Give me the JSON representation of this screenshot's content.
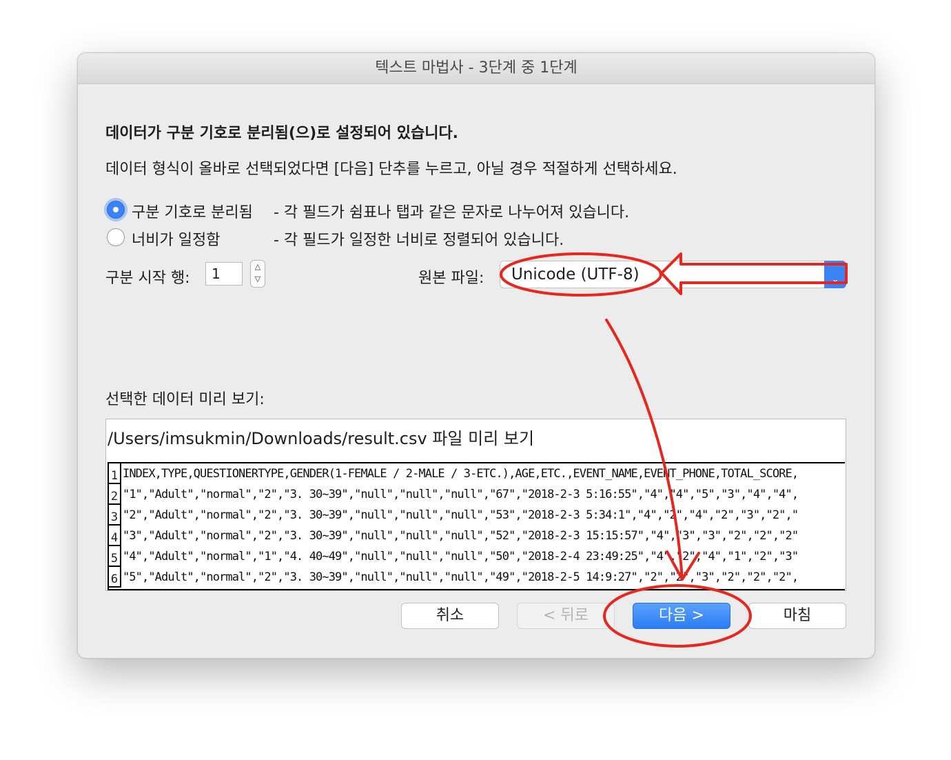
{
  "window": {
    "title": "텍스트 마법사 - 3단계 중 1단계"
  },
  "instructions": {
    "heading": "데이터가 구분 기호로 분리됨(으)로 설정되어 있습니다.",
    "subtext": "데이터 형식이 올바로 선택되었다면 [다음] 단추를 누르고, 아닐 경우 적절하게 선택하세요."
  },
  "options": [
    {
      "label": "구분 기호로 분리됨",
      "description": "- 각 필드가 쉼표나 탭과 같은 문자로 나누어져 있습니다.",
      "selected": true
    },
    {
      "label": "너비가 일정함",
      "description": "- 각 필드가 일정한 너비로 정렬되어 있습니다.",
      "selected": false
    }
  ],
  "start_row": {
    "label": "구분 시작 행:",
    "value": "1"
  },
  "origin": {
    "label": "원본 파일:",
    "value": "Unicode (UTF-8)"
  },
  "preview": {
    "label": "선택한 데이터 미리 보기:",
    "title": "/Users/imsukmin/Downloads/result.csv 파일 미리 보기",
    "rows": [
      {
        "num": "1",
        "text": "INDEX,TYPE,QUESTIONERTYPE,GENDER(1-FEMALE / 2-MALE / 3-ETC.),AGE,ETC.,EVENT_NAME,EVENT_PHONE,TOTAL_SCORE,"
      },
      {
        "num": "2",
        "text": "\"1\",\"Adult\",\"normal\",\"2\",\"3. 30~39\",\"null\",\"null\",\"null\",\"67\",\"2018-2-3 5:16:55\",\"4\",\"4\",\"5\",\"3\",\"4\",\"4\","
      },
      {
        "num": "3",
        "text": "\"2\",\"Adult\",\"normal\",\"2\",\"3. 30~39\",\"null\",\"null\",\"null\",\"53\",\"2018-2-3 5:34:1\",\"4\",\"2\",\"4\",\"2\",\"3\",\"2\",\""
      },
      {
        "num": "4",
        "text": "\"3\",\"Adult\",\"normal\",\"2\",\"3. 30~39\",\"null\",\"null\",\"null\",\"52\",\"2018-2-3 15:15:57\",\"4\",\"3\",\"3\",\"2\",\"2\",\"2\""
      },
      {
        "num": "5",
        "text": "\"4\",\"Adult\",\"normal\",\"1\",\"4. 40~49\",\"null\",\"null\",\"null\",\"50\",\"2018-2-4 23:49:25\",\"4\",\"2\",\"4\",\"1\",\"2\",\"3\""
      },
      {
        "num": "6",
        "text": "\"5\",\"Adult\",\"normal\",\"2\",\"3. 30~39\",\"null\",\"null\",\"null\",\"49\",\"2018-2-5 14:9:27\",\"2\",\"2\",\"3\",\"2\",\"2\",\"2\","
      }
    ]
  },
  "buttons": {
    "cancel": "취소",
    "back": "< 뒤로",
    "next": "다음 >",
    "finish": "마침"
  },
  "colors": {
    "accent": "#3b82f6",
    "annotation": "#e8261e"
  }
}
